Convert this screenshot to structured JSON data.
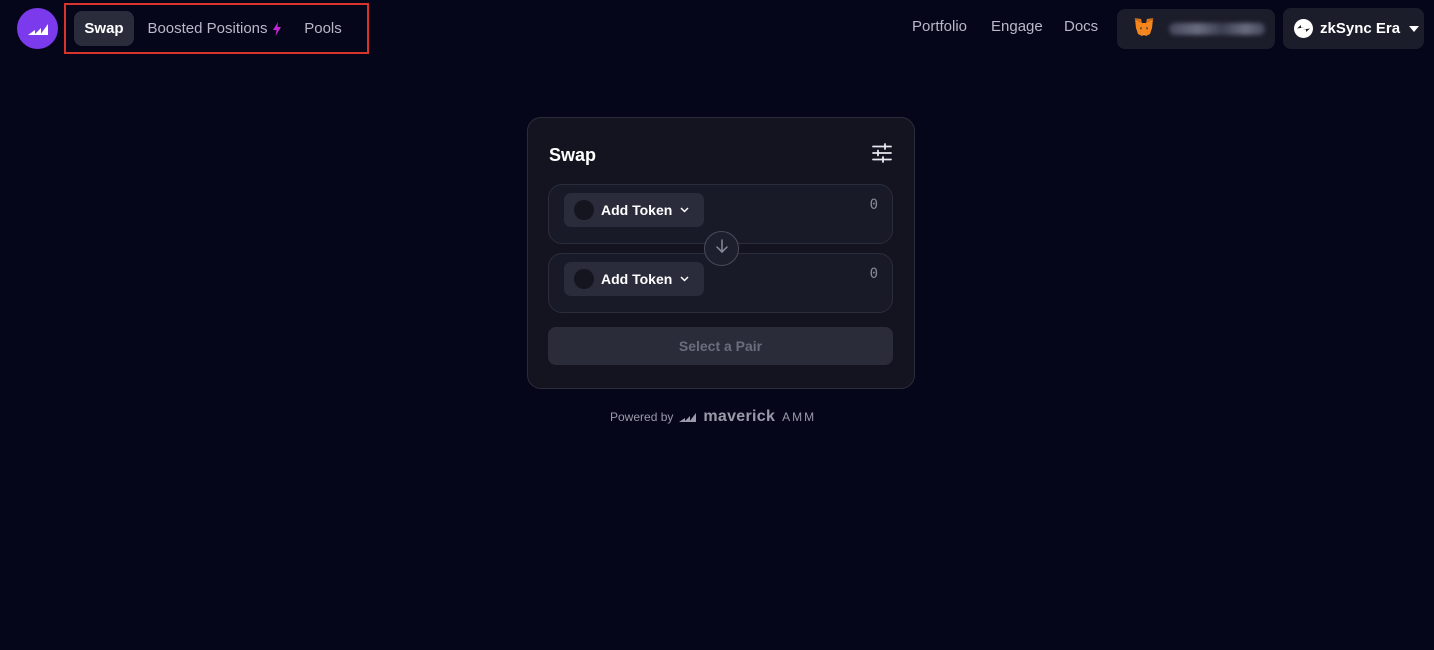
{
  "nav": {
    "items": [
      {
        "label": "Swap"
      },
      {
        "label": "Boosted Positions"
      },
      {
        "label": "Pools"
      }
    ]
  },
  "header": {
    "links": [
      {
        "label": "Portfolio"
      },
      {
        "label": "Engage"
      },
      {
        "label": "Docs"
      }
    ],
    "network": {
      "label": "zkSync Era"
    }
  },
  "swap_card": {
    "title": "Swap",
    "from_token": {
      "label": "Add Token",
      "amount": "0"
    },
    "to_token": {
      "label": "Add Token",
      "amount": "0"
    },
    "action_label": "Select a Pair"
  },
  "footer": {
    "powered_by": "Powered by",
    "brand": "maverick",
    "brand_suffix": "AMM"
  },
  "colors": {
    "background": "#06061a",
    "accent": "#7c3aed",
    "boost_icon": "#c026d3",
    "highlight": "#d9342b"
  },
  "icons": {
    "logo": "maverick-logo-icon",
    "settings": "sliders-icon",
    "swap": "arrow-down-icon",
    "wallet": "metamask-fox-icon",
    "network": "zksync-icon"
  }
}
